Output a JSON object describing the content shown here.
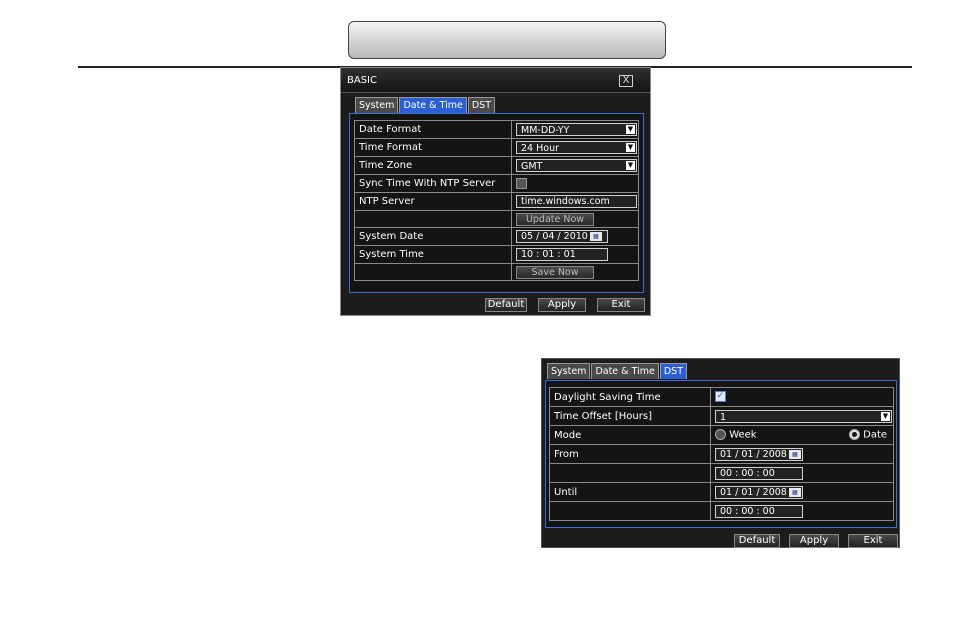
{
  "dialog1": {
    "title": "BASIC",
    "close": "X",
    "tabs": [
      "System",
      "Date & Time",
      "DST"
    ],
    "rows": {
      "date_format": {
        "label": "Date Format",
        "value": "MM-DD-YY"
      },
      "time_format": {
        "label": "Time Format",
        "value": "24 Hour"
      },
      "time_zone": {
        "label": "Time Zone",
        "value": "GMT"
      },
      "sync_ntp": {
        "label": "Sync Time With NTP Server"
      },
      "ntp_server": {
        "label": "NTP Server",
        "value": "time.windows.com"
      },
      "update_now": "Update Now",
      "system_date": {
        "label": "System Date",
        "value": "05 / 04 / 2010"
      },
      "system_time": {
        "label": "System Time",
        "value": "10 : 01 : 01"
      },
      "save_now": "Save Now"
    },
    "buttons": {
      "default": "Default",
      "apply": "Apply",
      "exit": "Exit"
    }
  },
  "dialog2": {
    "tabs": [
      "System",
      "Date & Time",
      "DST"
    ],
    "rows": {
      "dst": {
        "label": "Daylight Saving Time"
      },
      "offset": {
        "label": "Time Offset [Hours]",
        "value": "1"
      },
      "mode": {
        "label": "Mode",
        "week": "Week",
        "date": "Date"
      },
      "from": {
        "label": "From",
        "date": "01 / 01 / 2008",
        "time": "00 : 00 : 00"
      },
      "until": {
        "label": "Until",
        "date": "01 / 01 / 2008",
        "time": "00 : 00 : 00"
      }
    },
    "buttons": {
      "default": "Default",
      "apply": "Apply",
      "exit": "Exit"
    }
  },
  "icons": {
    "calendar": "calendar-icon",
    "dropdown": "chevron-down-icon",
    "check": "checkmark"
  },
  "colors": {
    "accent": "#2d5fd4",
    "panel_bg": "#1c1c1c"
  }
}
